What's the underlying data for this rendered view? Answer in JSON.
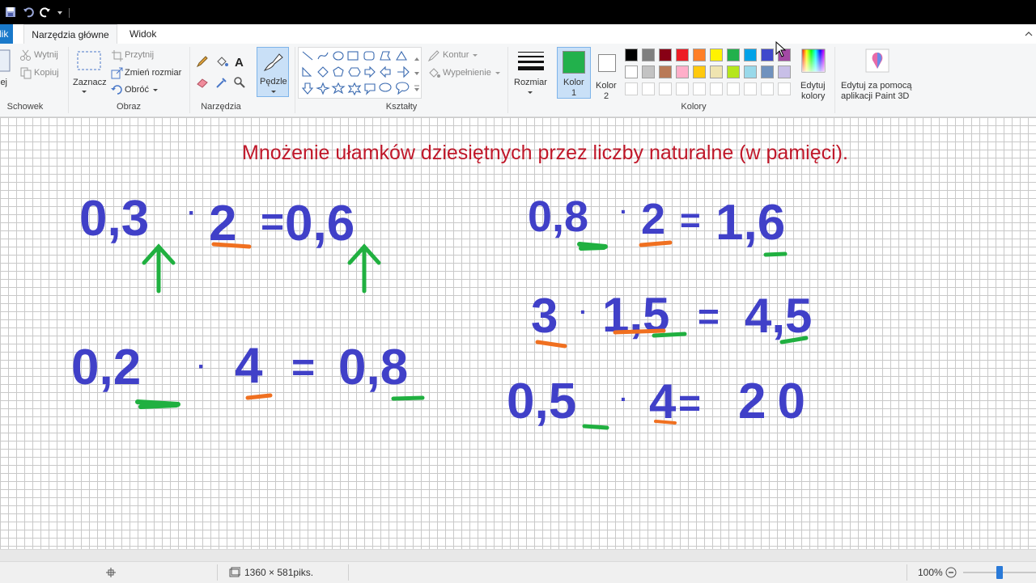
{
  "tabs": {
    "file": "lik",
    "home": "Narzędzia główne",
    "view": "Widok"
  },
  "clipboard": {
    "cut": "Wytnij",
    "copy": "Kopiuj",
    "paste": "lej",
    "group": "Schowek"
  },
  "image": {
    "select": "Zaznacz",
    "crop": "Przytnij",
    "resize": "Zmień rozmiar",
    "rotate": "Obróć",
    "group": "Obraz"
  },
  "tools": {
    "group": "Narzędzia"
  },
  "brushes": {
    "label": "Pędzle"
  },
  "shapes": {
    "outline": "Kontur",
    "fill": "Wypełnienie",
    "group": "Kształty"
  },
  "size": {
    "label": "Rozmiar"
  },
  "color1": {
    "label1": "Kolor",
    "label2": "1",
    "value": "#22b14c"
  },
  "color2": {
    "label1": "Kolor",
    "label2": "2",
    "value": "#ffffff"
  },
  "colors": {
    "group": "Kolory",
    "row1": [
      "#000000",
      "#7f7f7f",
      "#880015",
      "#ed1c24",
      "#ff7f27",
      "#fff200",
      "#22b14c",
      "#00a2e8",
      "#3f48cc",
      "#a349a4"
    ],
    "row2": [
      "#ffffff",
      "#c3c3c3",
      "#b97a57",
      "#ffaec9",
      "#ffc90e",
      "#efe4b0",
      "#b5e61d",
      "#99d9ea",
      "#7092be",
      "#c8bfe7"
    ]
  },
  "edit_colors": {
    "line1": "Edytuj",
    "line2": "kolory"
  },
  "paint3d": {
    "line1": "Edytuj za pomocą",
    "line2": "aplikacji Paint 3D"
  },
  "canvas": {
    "title": "Mnożenie ułamków dziesiętnych przez liczby naturalne (w pamięci).",
    "eq1": [
      "0,3",
      "·",
      "2",
      "=",
      "0,6"
    ],
    "eq2": [
      "0,2",
      "·",
      "4",
      "=",
      "0,8"
    ],
    "eq3": [
      "0,8",
      "·",
      "2",
      "=",
      "1,6"
    ],
    "eq4": [
      "3",
      "·",
      "1,5",
      "=",
      "4,5"
    ],
    "eq5": [
      "0,5",
      "·",
      "4",
      "=",
      "20"
    ]
  },
  "status": {
    "dimensions": "1360 × 581piks.",
    "zoom": "100%"
  }
}
